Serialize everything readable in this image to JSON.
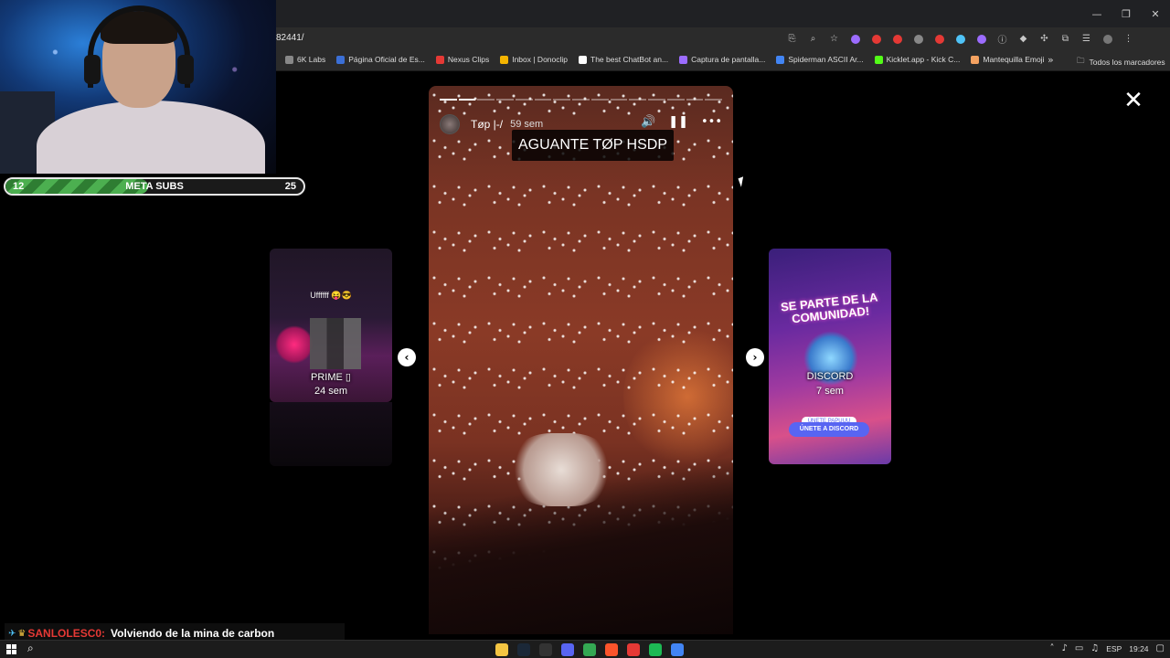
{
  "browser": {
    "url": "82441/",
    "window_controls": [
      "—",
      "❐",
      "✕"
    ],
    "bookmarks": [
      {
        "label": "6K Labs",
        "color": "#888888"
      },
      {
        "label": "Página Oficial de Es...",
        "color": "#3b6fd6"
      },
      {
        "label": "Nexus Clips",
        "color": "#e53935"
      },
      {
        "label": "Inbox | Donoclip",
        "color": "#f4b400"
      },
      {
        "label": "The best ChatBot an...",
        "color": "#ffffff"
      },
      {
        "label": "Captura de pantalla...",
        "color": "#9c6cff"
      },
      {
        "label": "Spiderman ASCII Ar...",
        "color": "#4285f4"
      },
      {
        "label": "Kicklet.app - Kick C...",
        "color": "#53fc18"
      },
      {
        "label": "Mantequilla Emoji",
        "color": "#f4a261"
      }
    ],
    "bookmarks_more": "»",
    "all_bookmarks": "Todos los marcadores"
  },
  "stream_overlay": {
    "sub_goal": {
      "current": "12",
      "label": "META SUBS",
      "target": "25",
      "progress": 0.48
    },
    "chat": {
      "username": "SANLOLESC0:",
      "message": "Volviendo de la mina de carbon"
    }
  },
  "story": {
    "username": "Tøp |-/",
    "time": "59 sem",
    "caption": "AGUANTE TØP HSDP",
    "segments_total": 15,
    "segments_done": 2,
    "controls": {
      "mute_icon": "🔊",
      "pause_icon": "❚❚",
      "more_icon": "•••"
    },
    "close_icon": "✕"
  },
  "side_cards": {
    "left": {
      "top_text": "Uffffff 😝😎",
      "title": "PRIME ▯",
      "time": "24 sem"
    },
    "right": {
      "banner": "SE PARTE DE LA COMUNIDAD!",
      "title": "DISCORD",
      "time": "7 sem",
      "tag": "ÚNETE PAPUUU",
      "button": "ÚNETE A DISCORD"
    }
  },
  "nav": {
    "prev": "‹",
    "next": "›"
  },
  "taskbar": {
    "apps": [
      {
        "name": "file-explorer",
        "color": "#f4c542"
      },
      {
        "name": "steam",
        "color": "#1b2838"
      },
      {
        "name": "obs",
        "color": "#333333"
      },
      {
        "name": "discord",
        "color": "#5865f2"
      },
      {
        "name": "chrome",
        "color": "#34a853"
      },
      {
        "name": "brave",
        "color": "#fb542b"
      },
      {
        "name": "youtube-music",
        "color": "#e53935"
      },
      {
        "name": "spotify",
        "color": "#1db954"
      },
      {
        "name": "app",
        "color": "#4285f4"
      }
    ],
    "language": "ESP",
    "time": "19:24"
  }
}
